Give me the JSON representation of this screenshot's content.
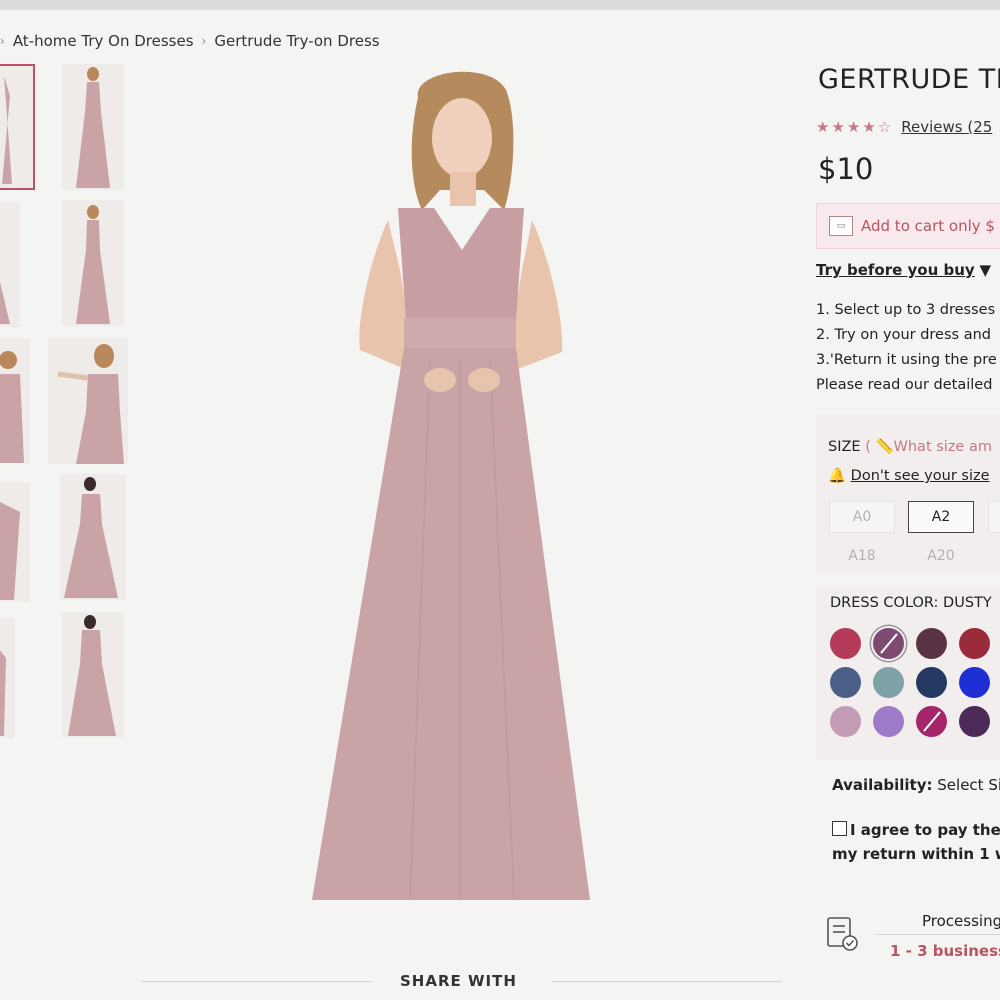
{
  "breadcrumb": {
    "items": [
      "At-home Try On Dresses",
      "Gertrude Try-on Dress"
    ]
  },
  "product": {
    "title": "GERTRUDE TI",
    "rating": 4.5,
    "reviews_label": "Reviews (25",
    "price": "$10",
    "add_to_cart_label": "Add to cart only $",
    "try_before": {
      "link": "Try before you buy",
      "caret": "▼"
    },
    "steps": [
      "1. Select up to 3 dresses",
      "2. Try on your dress and",
      "3.'Return it using the pre",
      "Please read our detailed"
    ]
  },
  "size": {
    "label": "SIZE",
    "guide_link": "What size am",
    "dont_see_link": "Don't see your size",
    "buttons": [
      "A0",
      "A2",
      "A18",
      "A20"
    ],
    "selected": "A2"
  },
  "dress_color": {
    "label": "DRESS COLOR: DUSTY",
    "swatches": [
      {
        "color": "#b43a5a",
        "selected": false,
        "unavailable": false
      },
      {
        "color": "#7d4a72",
        "selected": true,
        "unavailable": true
      },
      {
        "color": "#5a3444",
        "selected": false,
        "unavailable": false
      },
      {
        "color": "#9b2a3a",
        "selected": false,
        "unavailable": false
      },
      {
        "color": "#4b5f86",
        "selected": false,
        "unavailable": false
      },
      {
        "color": "#7ea2a8",
        "selected": false,
        "unavailable": false
      },
      {
        "color": "#253a63",
        "selected": false,
        "unavailable": false
      },
      {
        "color": "#1e2fd6",
        "selected": false,
        "unavailable": false
      },
      {
        "color": "#c39bb4",
        "selected": false,
        "unavailable": false
      },
      {
        "color": "#9f7ac8",
        "selected": false,
        "unavailable": false
      },
      {
        "color": "#a5256a",
        "selected": false,
        "unavailable": true
      },
      {
        "color": "#4d2a58",
        "selected": false,
        "unavailable": false
      }
    ]
  },
  "availability": {
    "label": "Availability:",
    "value": "Select Siz"
  },
  "agree": {
    "line1": "I agree to pay the",
    "line2": "my return within 1 w"
  },
  "processing": {
    "label": "Processing",
    "days": "1 - 3 business"
  },
  "share": {
    "label": "SHARE WITH"
  },
  "colors": {
    "accent": "#c0506a",
    "dress": "#c9a3a5",
    "cart_bg": "#f7e9ec",
    "link_red": "#b7565f"
  },
  "icons": [
    "chevron-right-icon",
    "star-icon",
    "cart-icon",
    "ruler-icon",
    "bell-icon",
    "checklist-icon"
  ]
}
